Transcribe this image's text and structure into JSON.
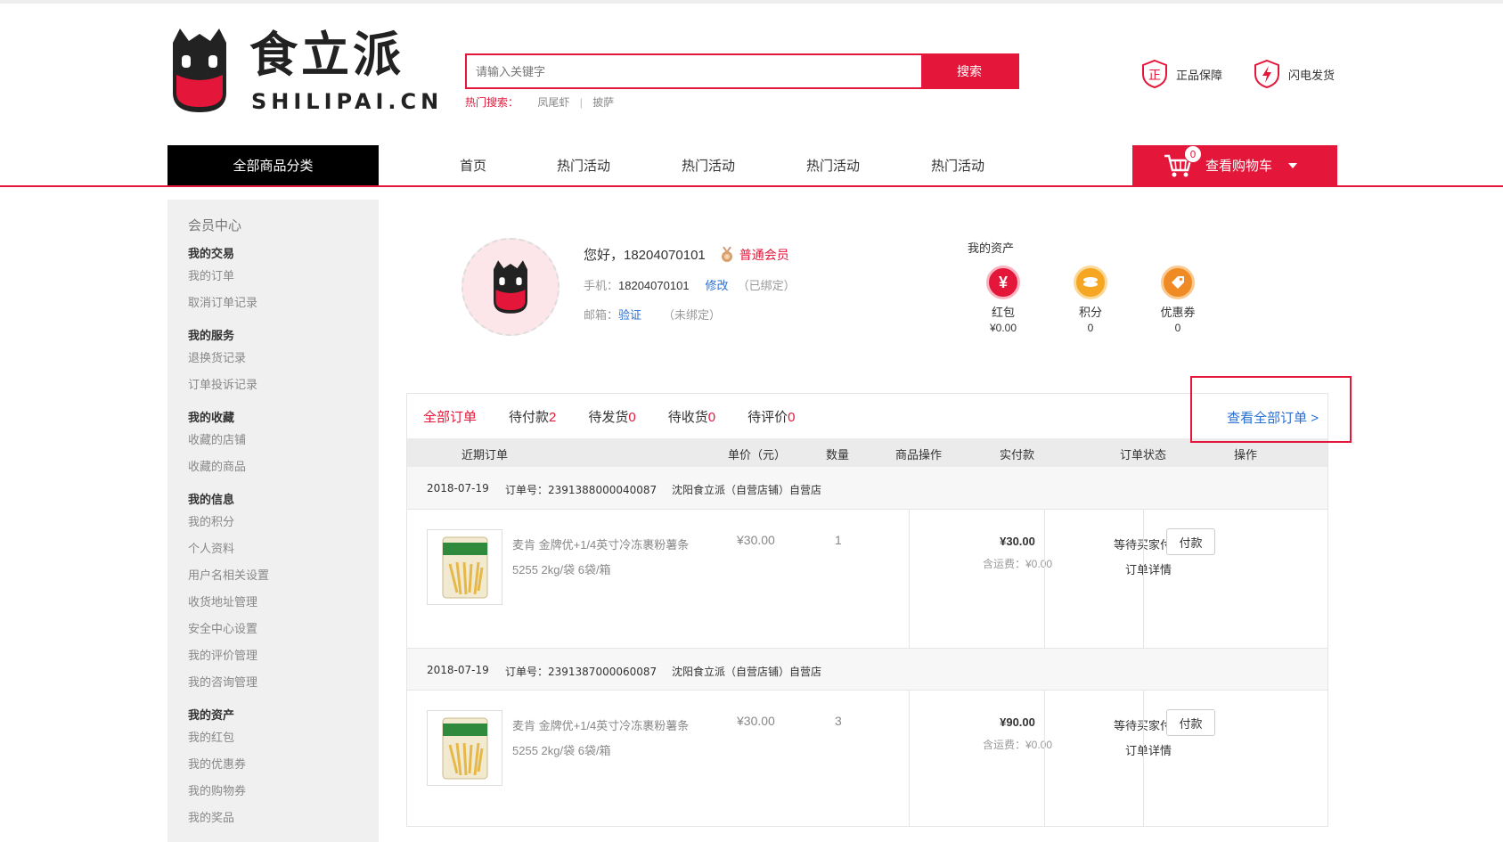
{
  "brand": {
    "name": "食立派",
    "domain": "SHILIPAI.CN"
  },
  "search": {
    "placeholder": "请输入关键字",
    "button": "搜索",
    "hot_label": "热门搜索：",
    "hot_keywords": [
      "凤尾虾",
      "披萨"
    ]
  },
  "promises": [
    {
      "label": "正品保障",
      "icon": "shield-zheng-icon"
    },
    {
      "label": "闪电发货",
      "icon": "shield-lightning-icon"
    }
  ],
  "nav": {
    "all_categories": "全部商品分类",
    "items": [
      "首页",
      "热门活动",
      "热门活动",
      "热门活动",
      "热门活动"
    ],
    "cart_label": "查看购物车",
    "cart_count": "0"
  },
  "sidebar": {
    "title": "会员中心",
    "groups": [
      {
        "name": "我的交易",
        "links": [
          "我的订单",
          "取消订单记录"
        ]
      },
      {
        "name": "我的服务",
        "links": [
          "退换货记录",
          "订单投诉记录"
        ]
      },
      {
        "name": "我的收藏",
        "links": [
          "收藏的店铺",
          "收藏的商品"
        ]
      },
      {
        "name": "我的信息",
        "links": [
          "我的积分",
          "个人资料",
          "用户名相关设置",
          "收货地址管理",
          "安全中心设置",
          "我的评价管理",
          "我的咨询管理"
        ]
      },
      {
        "name": "我的资产",
        "links": [
          "我的红包",
          "我的优惠券",
          "我的购物券",
          "我的奖品"
        ]
      }
    ]
  },
  "profile": {
    "greeting": "您好，18204070101",
    "level": "普通会员",
    "phone_label": "手机：",
    "phone": "18204070101",
    "phone_action": "修改",
    "phone_status": "（已绑定）",
    "email_label": "邮箱：",
    "email_action": "验证",
    "email_status": "（未绑定）"
  },
  "assets": {
    "title": "我的资产",
    "items": [
      {
        "label": "红包",
        "value": "¥0.00",
        "color": "#e4163a"
      },
      {
        "label": "积分",
        "value": "0",
        "color": "#f5a623"
      },
      {
        "label": "优惠券",
        "value": "0",
        "color": "#f08a24"
      }
    ]
  },
  "orders": {
    "tabs": [
      {
        "label": "全部订单",
        "count": ""
      },
      {
        "label": "待付款",
        "count": "2"
      },
      {
        "label": "待发货",
        "count": "0"
      },
      {
        "label": "待收货",
        "count": "0"
      },
      {
        "label": "待评价",
        "count": "0"
      }
    ],
    "view_all": "查看全部订单 >",
    "columns": [
      "近期订单",
      "单价（元）",
      "数量",
      "商品操作",
      "实付款",
      "订单状态",
      "操作"
    ],
    "list": [
      {
        "date": "2018-07-19",
        "order_no": "订单号：2391388000040087",
        "shop": "沈阳食立派（自营店铺）自营店",
        "product": "麦肯 金牌优+1/4英寸冷冻裹粉薯条5255 2kg/袋 6袋/箱",
        "unit_price": "¥30.00",
        "qty": "1",
        "paid": "¥30.00",
        "shipping": "含运费：¥0.00",
        "status": "等待买家付款",
        "detail": "订单详情",
        "action": "付款"
      },
      {
        "date": "2018-07-19",
        "order_no": "订单号：2391387000060087",
        "shop": "沈阳食立派（自营店铺）自营店",
        "product": "麦肯 金牌优+1/4英寸冷冻裹粉薯条5255 2kg/袋 6袋/箱",
        "unit_price": "¥30.00",
        "qty": "3",
        "paid": "¥90.00",
        "shipping": "含运费：¥0.00",
        "status": "等待买家付款",
        "detail": "订单详情",
        "action": "付款"
      }
    ]
  },
  "colors": {
    "accent": "#e4163a",
    "link": "#2a6fd1"
  }
}
